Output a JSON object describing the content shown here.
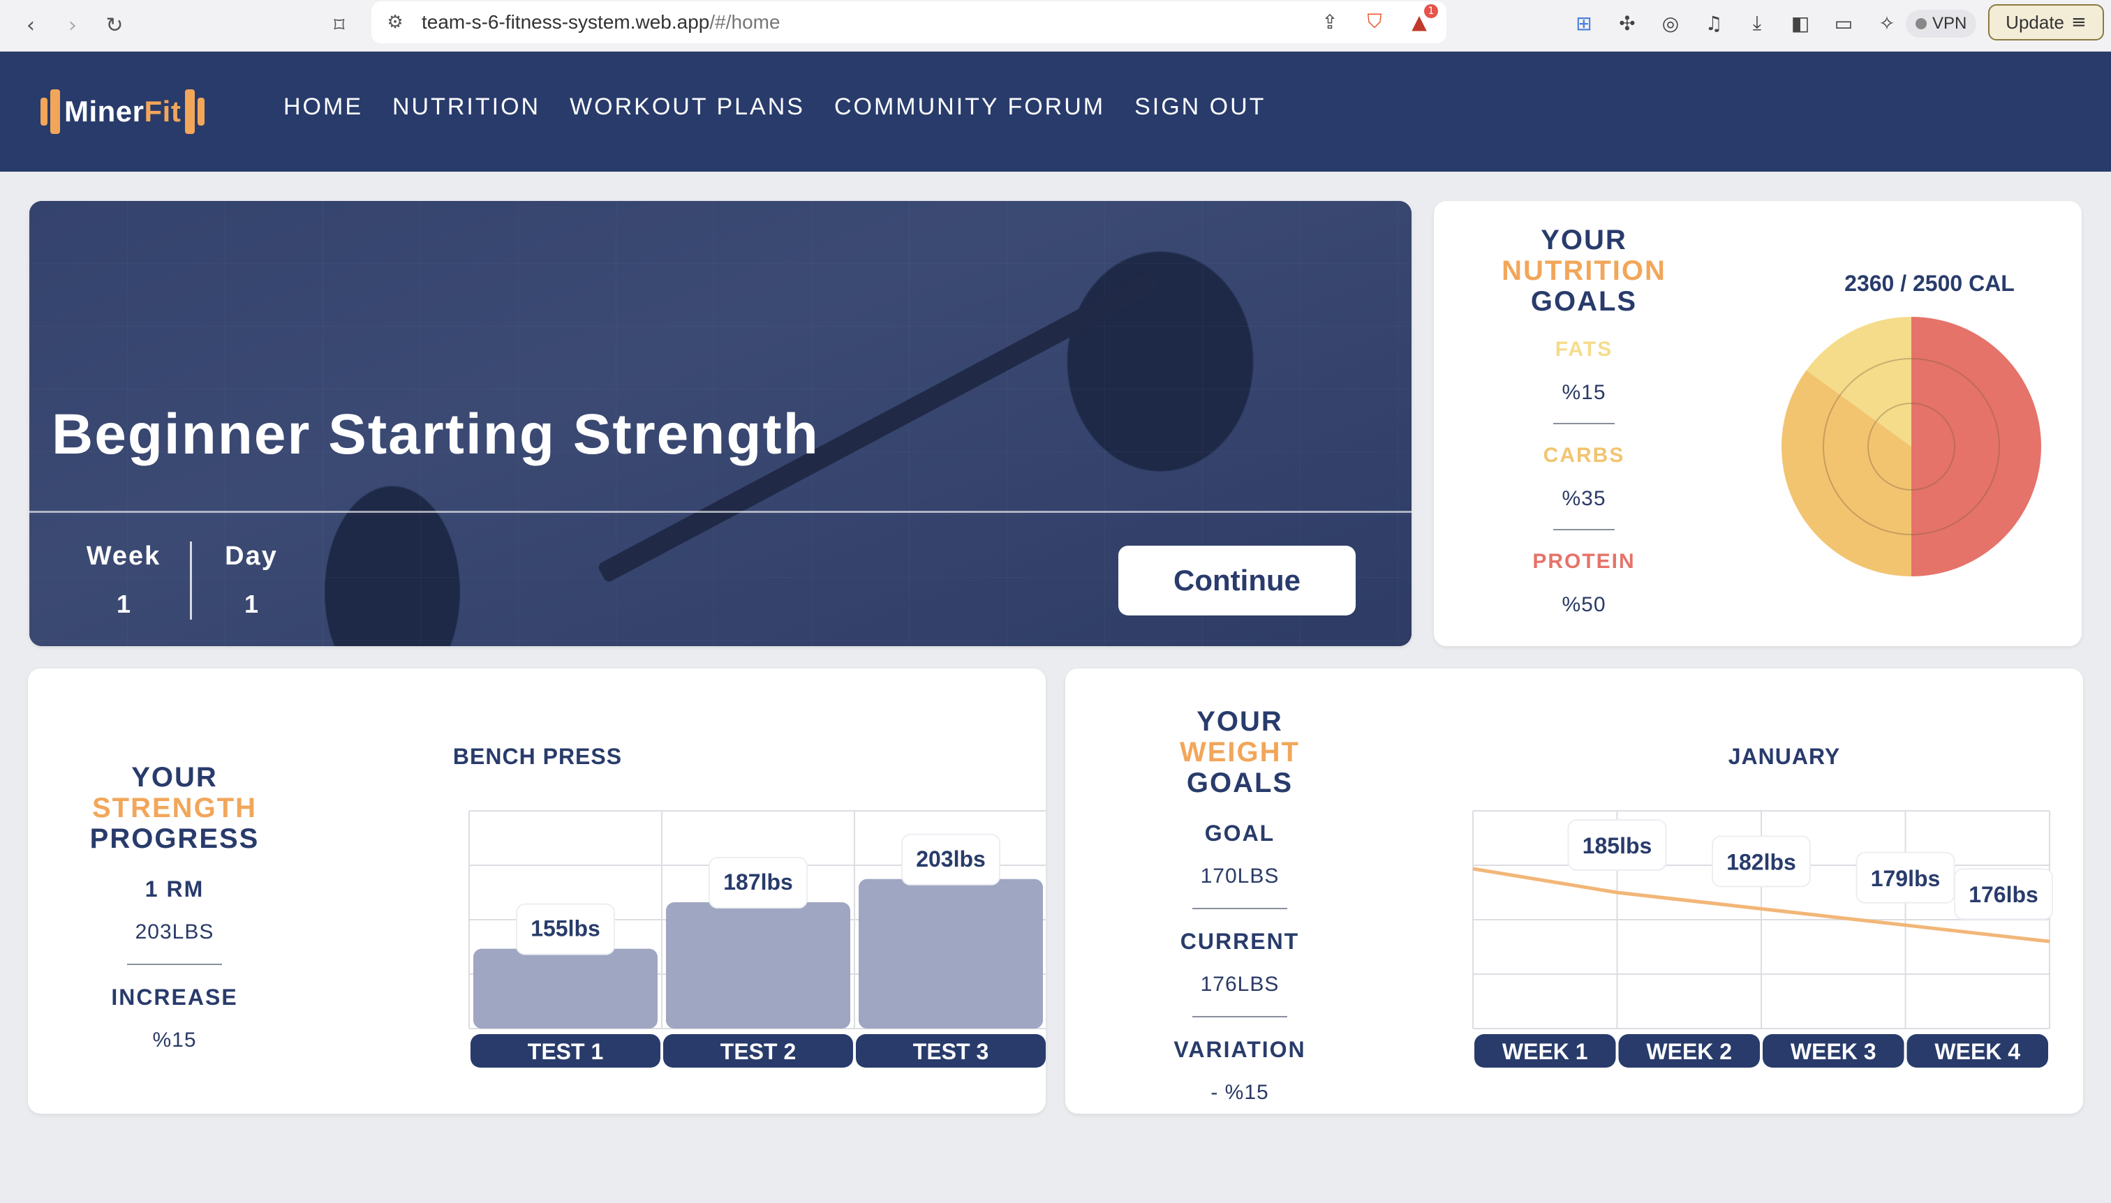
{
  "browser": {
    "url_host": "team-s-6-fitness-system.web.app",
    "url_path": "/#/home",
    "vpn_label": "VPN",
    "update_label": "Update",
    "shield_badge": "1"
  },
  "app": {
    "logo_main": "Miner",
    "logo_accent": "Fit",
    "nav": [
      "HOME",
      "NUTRITION",
      "WORKOUT PLANS",
      "COMMUNITY FORUM",
      "SIGN OUT"
    ]
  },
  "hero": {
    "title": "Beginner Starting Strength",
    "week_label": "Week",
    "week_value": "1",
    "day_label": "Day",
    "day_value": "1",
    "continue_label": "Continue"
  },
  "nutrition": {
    "title_line1": "YOUR",
    "title_line2": "NUTRITION",
    "title_line3": "GOALS",
    "calories": "2360 / 2500 CAL",
    "macros": [
      {
        "name": "FATS",
        "pct": "%15",
        "color": "#f5dc8a"
      },
      {
        "name": "CARBS",
        "pct": "%35",
        "color": "#f2c470"
      },
      {
        "name": "PROTEIN",
        "pct": "%50",
        "color": "#e5736a"
      }
    ]
  },
  "strength": {
    "title_line1_a": "YOUR ",
    "title_line1_b": "STRENGTH",
    "title_line2": "PROGRESS",
    "rm_label": "1 RM",
    "rm_value": "203LBS",
    "increase_label": "INCREASE",
    "increase_value": "%15"
  },
  "weight": {
    "title_line1_a": "YOUR ",
    "title_line1_b": "WEIGHT",
    "title_line2": "GOALS",
    "goal_label": "GOAL",
    "goal_value": "170LBS",
    "current_label": "CURRENT",
    "current_value": "176LBS",
    "variation_label": "VARIATION",
    "variation_value": "- %15"
  },
  "colors": {
    "navy": "#283b6b",
    "accent": "#f2a65a",
    "bar": "#9fa6c2",
    "line": "#f2b677"
  },
  "chart_data": [
    {
      "type": "pie",
      "categories": [
        "FATS",
        "CARBS",
        "PROTEIN"
      ],
      "values": [
        15,
        35,
        50
      ]
    },
    {
      "type": "bar",
      "title": "BENCH PRESS",
      "categories": [
        "TEST 1",
        "TEST 2",
        "TEST 3"
      ],
      "values": [
        155,
        187,
        203
      ],
      "labels": [
        "155lbs",
        "187lbs",
        "203lbs"
      ],
      "grid": true
    },
    {
      "type": "line",
      "title": "JANUARY",
      "categories": [
        "WEEK 1",
        "WEEK 2",
        "WEEK 3",
        "WEEK 4"
      ],
      "values": [
        185,
        182,
        179,
        176
      ],
      "labels": [
        "185lbs",
        "182lbs",
        "179lbs",
        "176lbs"
      ],
      "grid": true
    }
  ]
}
